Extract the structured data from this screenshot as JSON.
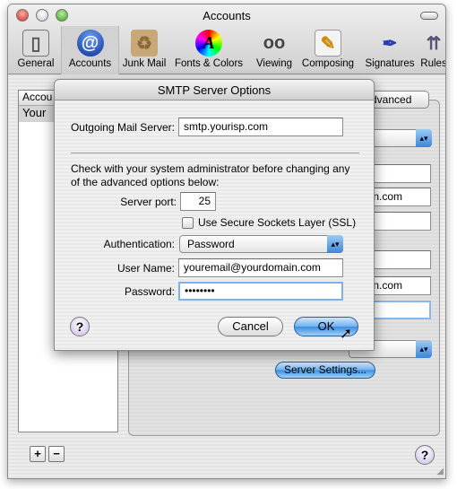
{
  "window": {
    "title": "Accounts"
  },
  "toolbar": [
    {
      "label": "General",
      "icon": "light-switch-icon"
    },
    {
      "label": "Accounts",
      "icon": "at-sign-icon"
    },
    {
      "label": "Junk Mail",
      "icon": "junk-box-icon"
    },
    {
      "label": "Fonts & Colors",
      "icon": "color-wheel-icon"
    },
    {
      "label": "Viewing",
      "icon": "glasses-icon"
    },
    {
      "label": "Composing",
      "icon": "pencil-note-icon"
    },
    {
      "label": "Signatures",
      "icon": "pen-icon"
    },
    {
      "label": "Rules",
      "icon": "rules-arrows-icon"
    }
  ],
  "background": {
    "list_header": "Accou",
    "list_item": "Your",
    "tab_label": "dvanced",
    "field_1": "ain.com",
    "field_2": "ain.com",
    "server_settings": "Server Settings...",
    "add": "+",
    "remove": "−",
    "help": "?"
  },
  "dialog": {
    "title": "SMTP Server Options",
    "outgoing_label": "Outgoing Mail Server:",
    "outgoing_value": "smtp.yourisp.com",
    "notice": "Check with your system administrator before changing any of the advanced options below:",
    "port_label": "Server port:",
    "port_value": "25",
    "ssl_label": "Use Secure Sockets Layer (SSL)",
    "ssl_checked": false,
    "auth_label": "Authentication:",
    "auth_value": "Password",
    "user_label": "User Name:",
    "user_value": "youremail@yourdomain.com",
    "password_label": "Password:",
    "password_value": "••••••••",
    "help": "?",
    "cancel": "Cancel",
    "ok": "OK"
  }
}
